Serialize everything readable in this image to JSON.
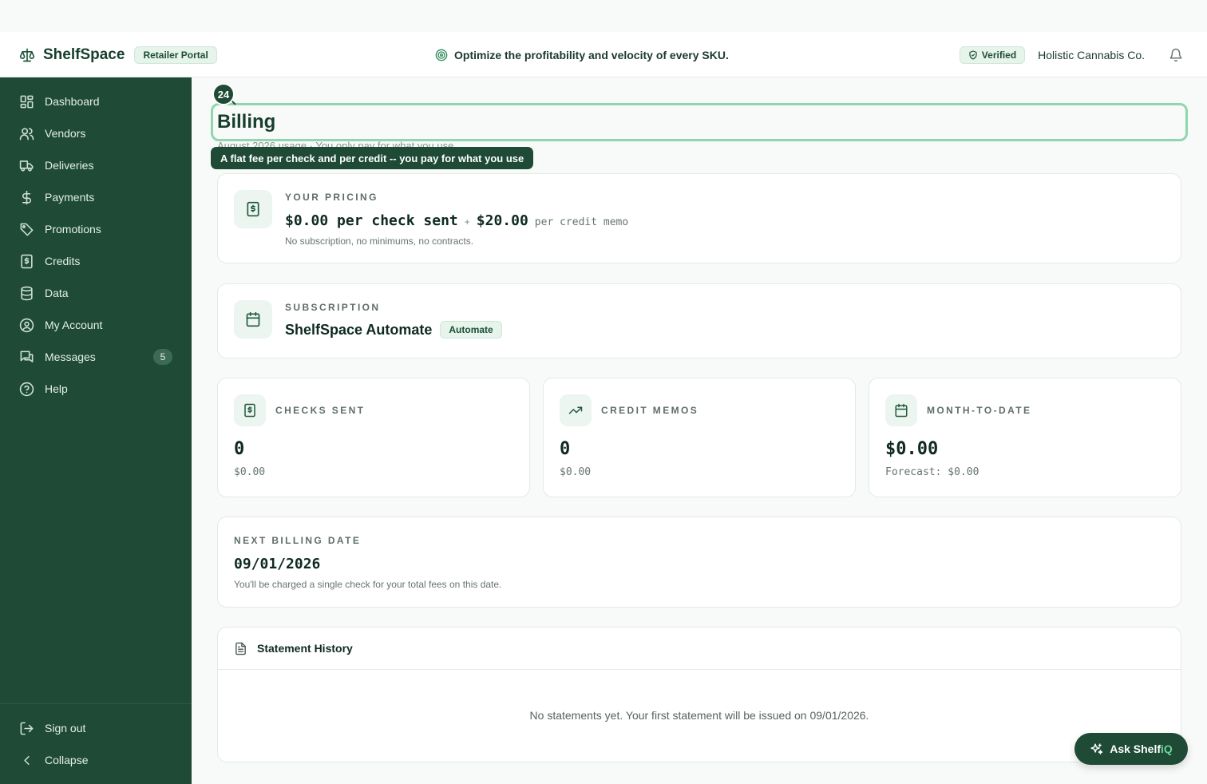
{
  "header": {
    "brand_name": "ShelfSpace",
    "portal_badge": "Retailer Portal",
    "tagline": "Optimize the profitability and velocity of every SKU.",
    "verified_label": "Verified",
    "company_name": "Holistic Cannabis Co."
  },
  "sidebar": {
    "items": [
      {
        "label": "Dashboard",
        "icon": "dashboard-icon"
      },
      {
        "label": "Vendors",
        "icon": "users-icon"
      },
      {
        "label": "Deliveries",
        "icon": "truck-icon"
      },
      {
        "label": "Payments",
        "icon": "dollar-icon"
      },
      {
        "label": "Promotions",
        "icon": "tag-icon"
      },
      {
        "label": "Credits",
        "icon": "receipt-icon"
      },
      {
        "label": "Data",
        "icon": "database-icon"
      },
      {
        "label": "My Account",
        "icon": "user-circle-icon"
      },
      {
        "label": "Messages",
        "icon": "messages-icon",
        "badge": "5"
      },
      {
        "label": "Help",
        "icon": "help-icon"
      }
    ],
    "sign_out": "Sign out",
    "collapse": "Collapse"
  },
  "page": {
    "title": "Billing",
    "subtitle": "August 2026 usage · You only pay for what you use",
    "step_number": "24",
    "tooltip": "A flat fee per check and per credit -- you pay for what you use"
  },
  "pricing": {
    "label": "YOUR PRICING",
    "check_price": "$0.00 per check sent",
    "plus": "+",
    "credit_price": "$20.00",
    "credit_unit": "per credit memo",
    "note": "No subscription, no minimums, no contracts."
  },
  "subscription": {
    "label": "SUBSCRIPTION",
    "name": "ShelfSpace Automate",
    "badge": "Automate"
  },
  "stats": [
    {
      "label": "CHECKS SENT",
      "value": "0",
      "sub": "$0.00",
      "icon": "receipt-icon"
    },
    {
      "label": "CREDIT MEMOS",
      "value": "0",
      "sub": "$0.00",
      "icon": "trending-up-icon"
    },
    {
      "label": "MONTH-TO-DATE",
      "value": "$0.00",
      "sub": "Forecast: $0.00",
      "icon": "calendar-icon"
    }
  ],
  "next_billing": {
    "label": "NEXT BILLING DATE",
    "date": "09/01/2026",
    "note": "You'll be charged a single check for your total fees on this date."
  },
  "statement_history": {
    "title": "Statement History",
    "empty": "No statements yet. Your first statement will be issued on 09/01/2026."
  },
  "assistant": {
    "label_prefix": "Ask Shelf",
    "label_suffix": "iQ"
  }
}
